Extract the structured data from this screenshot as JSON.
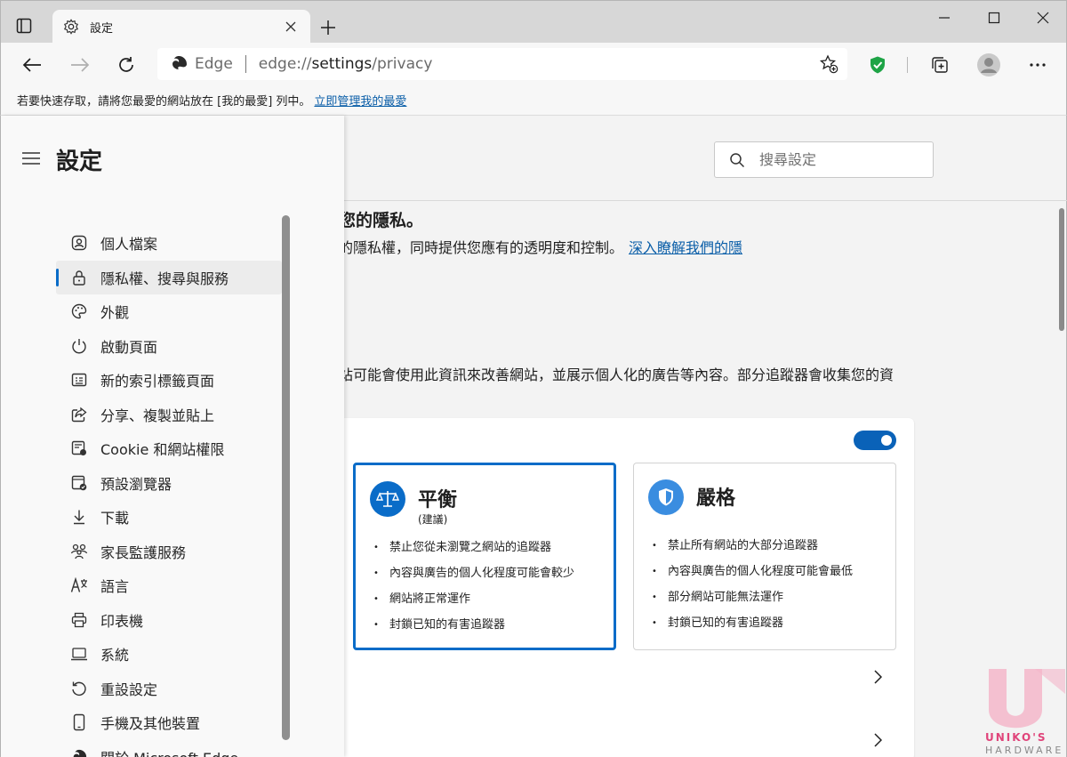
{
  "tab": {
    "title": "設定"
  },
  "address": {
    "edge_label": "Edge",
    "url_prefix": "edge://",
    "url_host": "settings",
    "url_path": "/privacy"
  },
  "favorites_bar": {
    "text": "若要快速存取，請將您最愛的網站放在 [我的最愛] 列中。",
    "link": "立即管理我的最愛"
  },
  "sidebar": {
    "title": "設定",
    "items": [
      {
        "label": "個人檔案",
        "icon": "profile-icon"
      },
      {
        "label": "隱私權、搜尋與服務",
        "icon": "lock-icon",
        "active": true
      },
      {
        "label": "外觀",
        "icon": "palette-icon"
      },
      {
        "label": "啟動頁面",
        "icon": "power-icon"
      },
      {
        "label": "新的索引標籤頁面",
        "icon": "new-tab-page-icon"
      },
      {
        "label": "分享、複製並貼上",
        "icon": "share-icon"
      },
      {
        "label": "Cookie 和網站權限",
        "icon": "cookie-icon"
      },
      {
        "label": "預設瀏覽器",
        "icon": "default-browser-icon"
      },
      {
        "label": "下載",
        "icon": "download-icon"
      },
      {
        "label": "家長監護服務",
        "icon": "family-icon"
      },
      {
        "label": "語言",
        "icon": "language-icon"
      },
      {
        "label": "印表機",
        "icon": "printer-icon"
      },
      {
        "label": "系統",
        "icon": "laptop-icon"
      },
      {
        "label": "重設設定",
        "icon": "reset-icon"
      },
      {
        "label": "手機及其他裝置",
        "icon": "phone-icon"
      },
      {
        "label": "關於 Microsoft Edge",
        "icon": "edge-logo-icon"
      }
    ]
  },
  "search": {
    "placeholder": "搜尋設定"
  },
  "main": {
    "heading": "您的隱私。",
    "description": "的隱私權，同時提供您應有的透明度和控制。",
    "learn_more": "深入瞭解我們的隱",
    "tracker_description": "站可能會使用此資訊來改善網站，並展示個人化的廣告等內容。部分追蹤器會收集您的資"
  },
  "prevention": {
    "enabled": true,
    "balanced": {
      "title": "平衡",
      "subtitle": "(建議)",
      "bullets": [
        "禁止您從未瀏覽之網站的追蹤器",
        "內容與廣告的個人化程度可能會較少",
        "網站將正常運作",
        "封鎖已知的有害追蹤器"
      ]
    },
    "strict": {
      "title": "嚴格",
      "bullets": [
        "禁止所有網站的大部分追蹤器",
        "內容與廣告的個人化程度可能會最低",
        "部分網站可能無法運作",
        "封鎖已知的有害追蹤器"
      ]
    }
  },
  "watermark": {
    "line1": "UNIKO'S",
    "line2": "HARDWARE"
  },
  "colors": {
    "accent": "#0a6cc8",
    "link": "#0a5ea8",
    "shield": "#1ea446"
  }
}
